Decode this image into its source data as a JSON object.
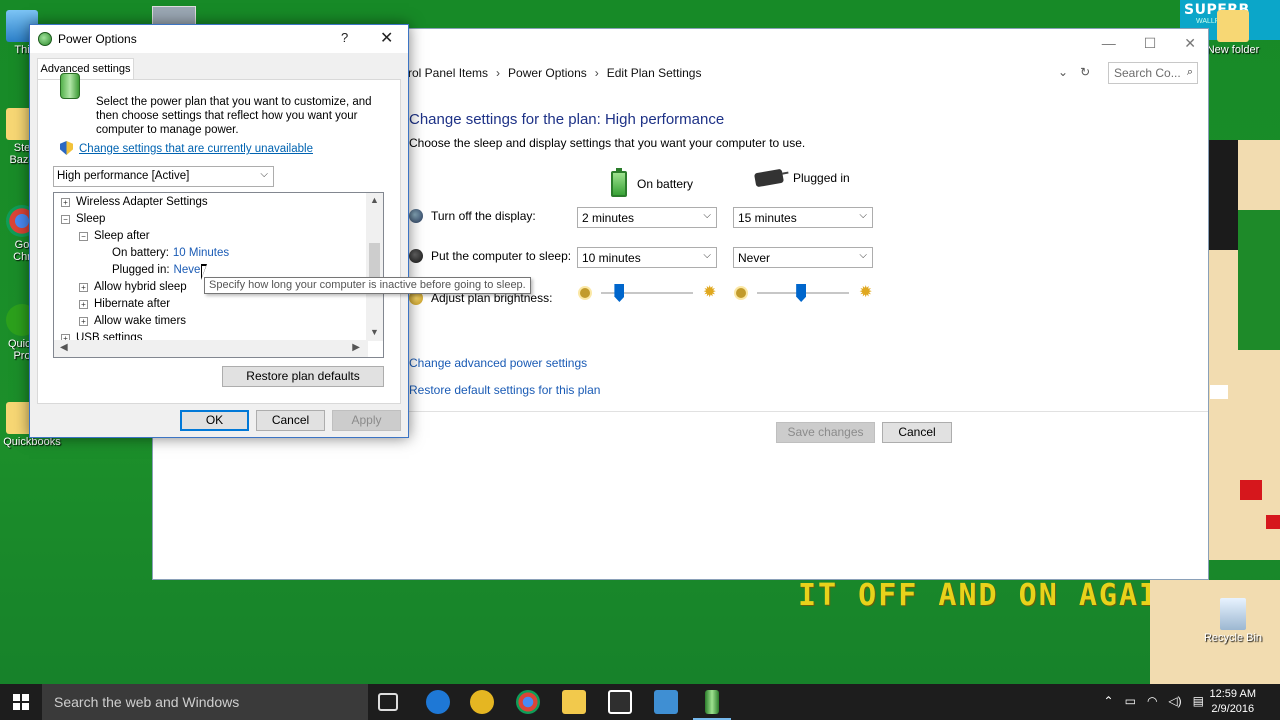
{
  "wallpaper": {
    "brand": "SUPERB",
    "brand_sub": "WALLPAPERS",
    "slogan": "IT OFF AND ON AGAIN?"
  },
  "desktop_icons": [
    {
      "label": "Thi",
      "icon": "this-pc-icon"
    },
    {
      "label": "Ste\nBaze",
      "icon": "folder-icon"
    },
    {
      "label": "Go\nChr",
      "icon": "chrome-icon"
    },
    {
      "label": "Quick\nPro",
      "icon": "quickbooks-icon"
    },
    {
      "label": "Quickbooks",
      "icon": "folder-icon"
    },
    {
      "label": "New folder",
      "icon": "folder-icon"
    },
    {
      "label": "Recycle Bin",
      "icon": "recycle-bin-icon"
    }
  ],
  "control_panel": {
    "breadcrumb": [
      "ntrol Panel Items",
      "Power Options",
      "Edit Plan Settings"
    ],
    "search_placeholder": "Search Co...",
    "heading": "Change settings for the plan: High performance",
    "subheading": "Choose the sleep and display settings that you want your computer to use.",
    "columns": {
      "battery": "On battery",
      "plugged": "Plugged in"
    },
    "rows": [
      {
        "label": "Turn off the display:",
        "battery": "2 minutes",
        "plugged": "15 minutes"
      },
      {
        "label": "Put the computer to sleep:",
        "battery": "10 minutes",
        "plugged": "Never"
      }
    ],
    "brightness_label": "Adjust plan brightness:",
    "brightness": {
      "battery": 0.2,
      "plugged": 0.48
    },
    "links": [
      "Change advanced power settings",
      "Restore default settings for this plan"
    ],
    "save_label": "Save changes",
    "cancel_label": "Cancel"
  },
  "dialog": {
    "title": "Power Options",
    "help": "?",
    "close": "✕",
    "tab": "Advanced settings",
    "description": "Select the power plan that you want to customize, and then choose settings that reflect how you want your computer to manage power.",
    "unavailable_link": "Change settings that are currently unavailable",
    "plan_select": "High performance [Active]",
    "tree": [
      {
        "label": "Wireless Adapter Settings",
        "exp": "+",
        "level": 0
      },
      {
        "label": "Sleep",
        "exp": "−",
        "level": 0
      },
      {
        "label": "Sleep after",
        "exp": "−",
        "level": 1
      },
      {
        "label": "On battery:",
        "value": "10 Minutes",
        "level": 2
      },
      {
        "label": "Plugged in:",
        "value": "Never",
        "level": 2
      },
      {
        "label": "Allow hybrid sleep",
        "exp": "+",
        "level": 1
      },
      {
        "label": "Hibernate after",
        "exp": "+",
        "level": 1
      },
      {
        "label": "Allow wake timers",
        "exp": "+",
        "level": 1
      },
      {
        "label": "USB settings",
        "exp": "+",
        "level": 0
      }
    ],
    "tooltip": "Specify how long your computer is inactive before going to sleep.",
    "restore_label": "Restore plan defaults",
    "ok_label": "OK",
    "cancel_label": "Cancel",
    "apply_label": "Apply"
  },
  "taskbar": {
    "search_placeholder": "Search the web and Windows",
    "time": "12:59 AM",
    "date": "2/9/2016"
  }
}
